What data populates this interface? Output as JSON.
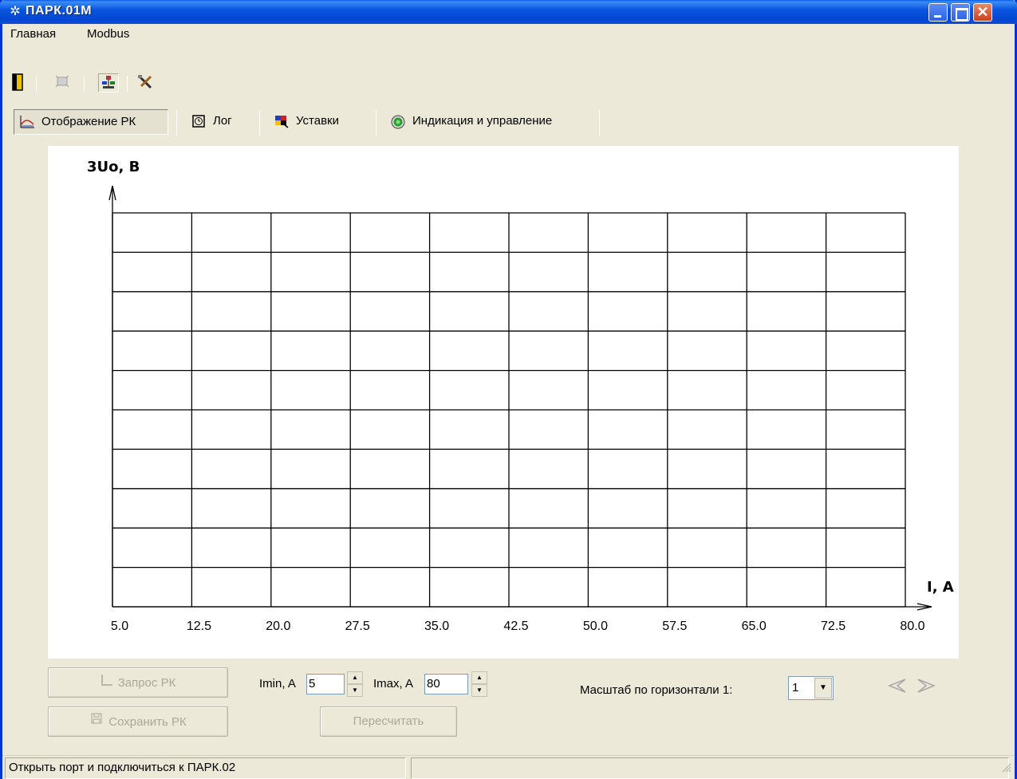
{
  "window": {
    "title": "ПАРК.01М",
    "icon": "gear-icon",
    "controls": [
      "minimize-icon",
      "maximize-icon",
      "close-icon"
    ]
  },
  "menu": {
    "items": [
      {
        "label": "Главная"
      },
      {
        "label": "Modbus"
      }
    ]
  },
  "toolbar": {
    "icons": [
      "exit-icon",
      "device-icon",
      "connect-icon",
      "tools-icon"
    ]
  },
  "tabs": [
    {
      "label": "Отображение РК",
      "icon": "chart-icon",
      "active": true
    },
    {
      "label": "Лог",
      "icon": "clock-icon",
      "active": false
    },
    {
      "label": "Уставки",
      "icon": "settings-icon",
      "active": false
    },
    {
      "label": "Индикация и управление",
      "icon": "indicator-icon",
      "active": false
    }
  ],
  "chart_data": {
    "type": "line",
    "ylabel": "3Uo, В",
    "xlabel": "I, А",
    "x_ticks": [
      "5.0",
      "12.5",
      "20.0",
      "27.5",
      "35.0",
      "42.5",
      "50.0",
      "57.5",
      "65.0",
      "72.5",
      "80.0"
    ],
    "xlim": [
      5.0,
      80.0
    ],
    "y_divisions": 10,
    "grid": true,
    "series": []
  },
  "controls": {
    "request_label": "Запрос РК",
    "save_label": "Сохранить РК",
    "imin_label": "Imin, A",
    "imin_value": "5",
    "imax_label": "Imax, A",
    "imax_value": "80",
    "recalc_label": "Пересчитать",
    "scale_label": "Масштаб по горизонтали 1:",
    "scale_value": "1"
  },
  "status": {
    "message": "Открыть порт и подключиться к ПАРК.02"
  }
}
